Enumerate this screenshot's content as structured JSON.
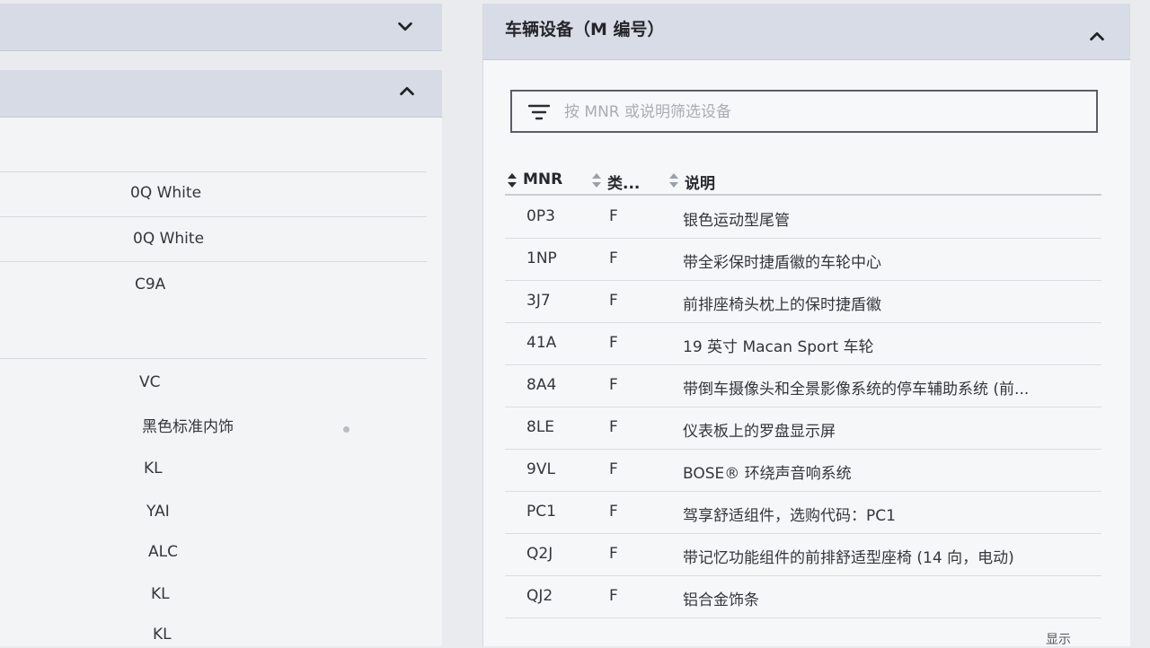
{
  "left": {
    "values": [
      "0Q White",
      "0Q White",
      "C9A",
      "VC",
      "黑色标准内饰",
      "KL",
      "YAI",
      "ALC",
      "KL",
      "KL"
    ]
  },
  "equipment": {
    "title": "车辆设备（M 编号）",
    "filter_placeholder": "按 MNR 或说明筛选设备",
    "columns": {
      "mnr": "MNR",
      "type": "类...",
      "desc": "说明"
    },
    "rows": [
      {
        "mnr": "0P3",
        "type": "F",
        "desc": "银色运动型尾管"
      },
      {
        "mnr": "1NP",
        "type": "F",
        "desc": "带全彩保时捷盾徽的车轮中心"
      },
      {
        "mnr": "3J7",
        "type": "F",
        "desc": "前排座椅头枕上的保时捷盾徽"
      },
      {
        "mnr": "41A",
        "type": "F",
        "desc": "19 英寸 Macan Sport 车轮"
      },
      {
        "mnr": "8A4",
        "type": "F",
        "desc": "带倒车摄像头和全景影像系统的停车辅助系统 (前..."
      },
      {
        "mnr": "8LE",
        "type": "F",
        "desc": "仪表板上的罗盘显示屏"
      },
      {
        "mnr": "9VL",
        "type": "F",
        "desc": "BOSE® 环绕声音响系统"
      },
      {
        "mnr": "PC1",
        "type": "F",
        "desc": "驾享舒适组件，选购代码：PC1"
      },
      {
        "mnr": "Q2J",
        "type": "F",
        "desc": "带记忆功能组件的前排舒适型座椅 (14 向，电动)"
      },
      {
        "mnr": "QJ2",
        "type": "F",
        "desc": "铝合金饰条"
      }
    ],
    "footer_text": "显示"
  }
}
